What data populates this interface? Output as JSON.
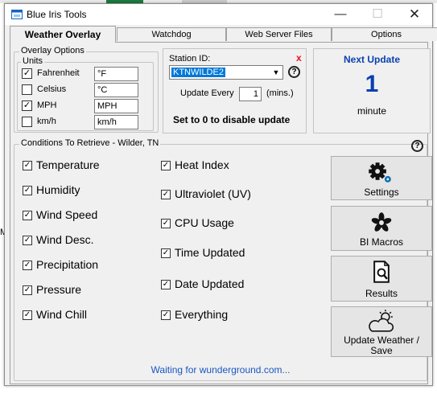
{
  "background": {
    "left_fragment": "M"
  },
  "window": {
    "title": "Blue Iris Tools",
    "controls": {
      "minimize": "—",
      "maximize": "☐",
      "close": "✕"
    }
  },
  "tabs": [
    {
      "label": "Weather Overlay",
      "active": true
    },
    {
      "label": "Watchdog",
      "active": false
    },
    {
      "label": "Web Server Files",
      "active": false
    },
    {
      "label": "Options",
      "active": false
    }
  ],
  "overlay_options": {
    "legend": "Overlay Options",
    "units_legend": "Units",
    "units": [
      {
        "label": "Fahrenheit",
        "checked": true,
        "value": "°F"
      },
      {
        "label": "Celsius",
        "checked": false,
        "value": "°C"
      },
      {
        "label": "MPH",
        "checked": true,
        "value": "MPH"
      },
      {
        "label": "km/h",
        "checked": false,
        "value": "km/h"
      }
    ]
  },
  "station": {
    "label": "Station ID:",
    "clear_glyph": "x",
    "selected_value": "KTNWILDE2",
    "update_every_label": "Update Every",
    "update_every_value": "1",
    "update_every_unit": "(mins.)",
    "hint": "Set to 0 to disable update",
    "help_glyph": "?"
  },
  "next_update": {
    "title": "Next Update",
    "value": "1",
    "unit": "minute"
  },
  "conditions": {
    "legend": "Conditions To Retrieve - Wilder, TN",
    "help_glyph": "?",
    "left": [
      {
        "label": "Temperature",
        "checked": true
      },
      {
        "label": "Humidity",
        "checked": true
      },
      {
        "label": "Wind Speed",
        "checked": true
      },
      {
        "label": "Wind Desc.",
        "checked": true
      },
      {
        "label": "Precipitation",
        "checked": true
      },
      {
        "label": "Pressure",
        "checked": true
      },
      {
        "label": "Wind Chill",
        "checked": true
      }
    ],
    "right": [
      {
        "label": "Heat Index",
        "checked": true
      },
      {
        "label": "Ultraviolet (UV)",
        "checked": true
      },
      {
        "label": "CPU Usage",
        "checked": true
      },
      {
        "label": "Time Updated",
        "checked": true
      },
      {
        "label": "Date Updated",
        "checked": true
      },
      {
        "label": "Everything",
        "checked": true
      }
    ]
  },
  "buttons": {
    "settings": {
      "label": "Settings",
      "icon": "gears-icon"
    },
    "bi_macros": {
      "label": "BI Macros",
      "icon": "flower-icon"
    },
    "results": {
      "label": "Results",
      "icon": "document-search-icon"
    },
    "update": {
      "label_line1": "Update Weather /",
      "label_line2": "Save",
      "icon": "partly-cloudy-icon"
    }
  },
  "status_text": "Waiting for wunderground.com...",
  "colors": {
    "accent_blue": "#0a3fb0",
    "status_blue": "#1a56c4",
    "clear_red": "#e81123",
    "selection_blue": "#0078d7"
  },
  "check_glyph": "✓"
}
